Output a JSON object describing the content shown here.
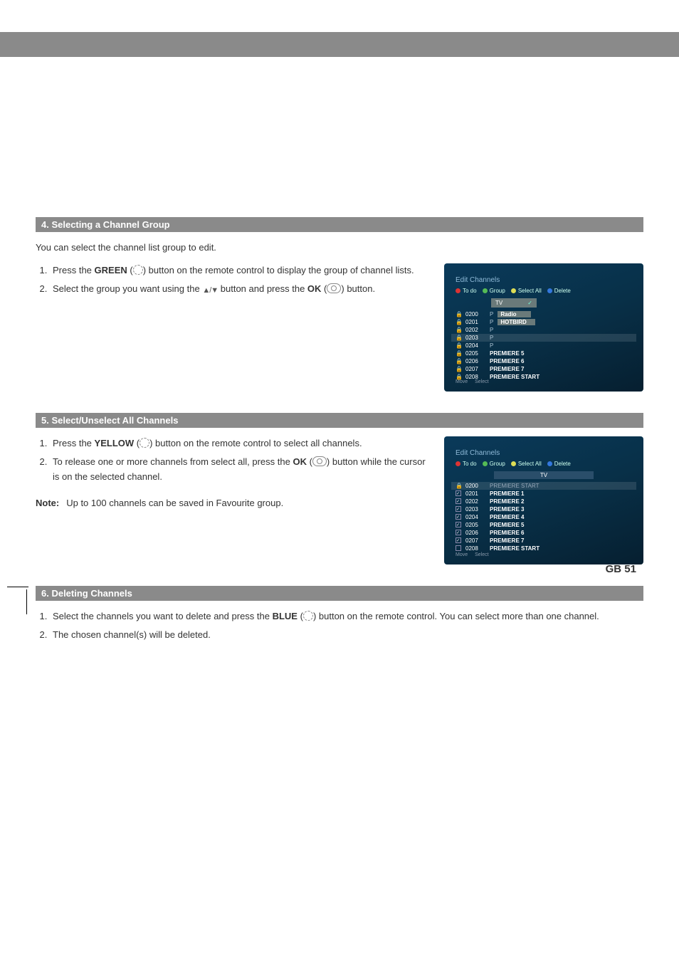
{
  "page_number": "GB 51",
  "sections": {
    "s4": {
      "heading": "4. Selecting a Channel Group",
      "intro": "You can select the channel list group to edit.",
      "step1_a": "Press the ",
      "step1_b": "GREEN",
      "step1_c": " button on the remote control to display the group of channel lists.",
      "step2_a": "Select the group you want using the ",
      "step2_b": " button and press the ",
      "step2_c": "OK",
      "step2_d": " button."
    },
    "s5": {
      "heading": "5. Select/Unselect All Channels",
      "step1_a": "Press the ",
      "step1_b": "YELLOW",
      "step1_c": " button on the remote control to select all channels.",
      "step2_a": "To release one or more channels from select all, press the ",
      "step2_b": "OK",
      "step2_c": " button while the cursor is on the selected channel.",
      "note_label": "Note:",
      "note_text": "Up to 100 channels can be saved in Favourite group."
    },
    "s6": {
      "heading": "6. Deleting Channels",
      "step1_a": "Select the channels you want to delete and press the ",
      "step1_b": "BLUE",
      "step1_c": " button on the remote control. You can select more than one channel.",
      "step2": "The chosen channel(s) will be deleted."
    }
  },
  "screenshot1": {
    "title": "Edit Channels",
    "menu": {
      "todo": "To do",
      "group": "Group",
      "select_all": "Select All",
      "delete": "Delete"
    },
    "dropdown_label": "TV",
    "rows": [
      {
        "num": "0200",
        "p": "P",
        "name": "Radio",
        "type": "dd"
      },
      {
        "num": "0201",
        "p": "P",
        "name": "HOTBIRD",
        "type": "dd"
      },
      {
        "num": "0202",
        "p": "P",
        "name": ""
      },
      {
        "num": "0203",
        "p": "P",
        "name": "",
        "sel": true
      },
      {
        "num": "0204",
        "p": "P",
        "name": ""
      },
      {
        "num": "0205",
        "p": "",
        "name": "PREMIERE 5"
      },
      {
        "num": "0206",
        "p": "",
        "name": "PREMIERE 6"
      },
      {
        "num": "0207",
        "p": "",
        "name": "PREMIERE 7"
      },
      {
        "num": "0208",
        "p": "",
        "name": "PREMIERE START"
      }
    ],
    "foot": {
      "move": "Move",
      "select": "Select"
    }
  },
  "screenshot2": {
    "title": "Edit Channels",
    "menu": {
      "todo": "To do",
      "group": "Group",
      "select_all": "Select All",
      "delete": "Delete"
    },
    "tab": "TV",
    "rows": [
      {
        "num": "0200",
        "name": "PREMIERE START",
        "sel": true
      },
      {
        "num": "0201",
        "name": "PREMIERE 1"
      },
      {
        "num": "0202",
        "name": "PREMIERE 2"
      },
      {
        "num": "0203",
        "name": "PREMIERE 3"
      },
      {
        "num": "0204",
        "name": "PREMIERE 4"
      },
      {
        "num": "0205",
        "name": "PREMIERE 5"
      },
      {
        "num": "0206",
        "name": "PREMIERE 6"
      },
      {
        "num": "0207",
        "name": "PREMIERE 7"
      },
      {
        "num": "0208",
        "name": "PREMIERE START"
      }
    ],
    "foot": {
      "move": "Move",
      "select": "Select"
    }
  }
}
